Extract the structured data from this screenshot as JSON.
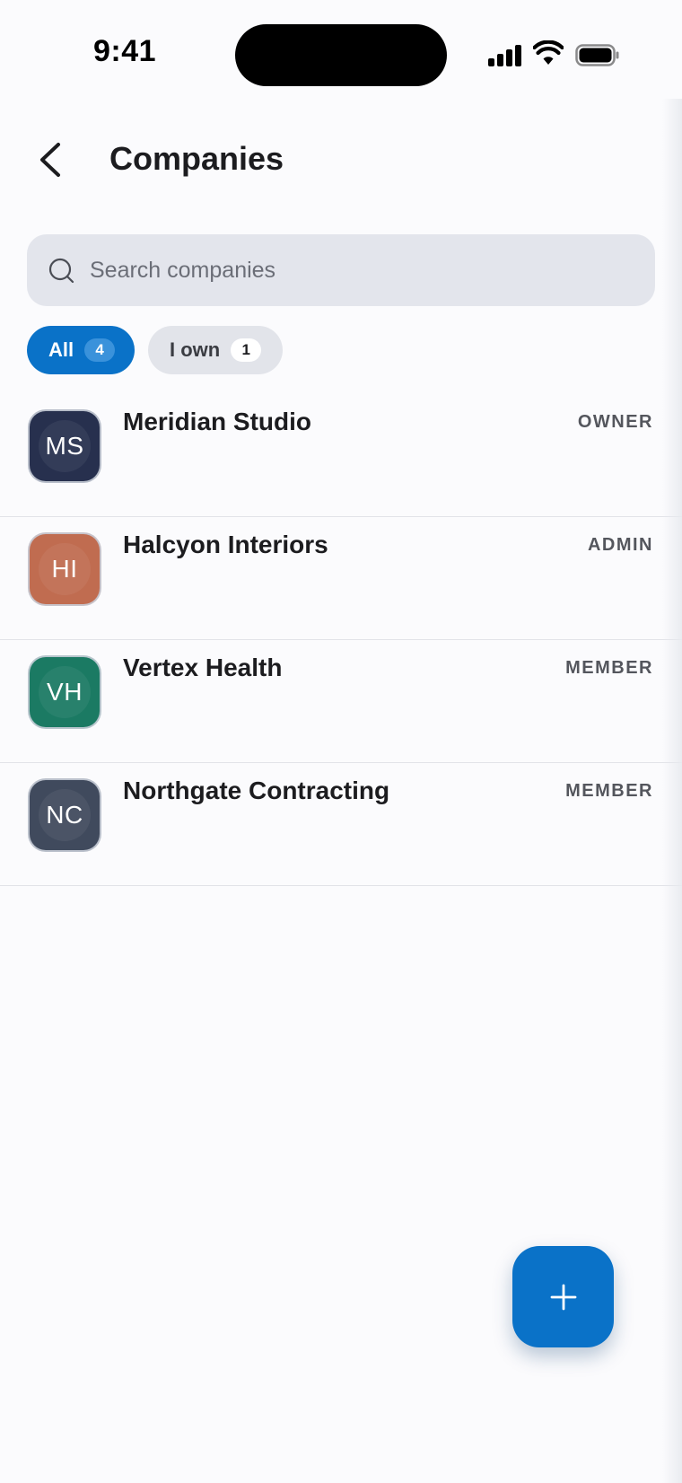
{
  "status_bar": {
    "time": "9:41"
  },
  "header": {
    "title": "Companies"
  },
  "search": {
    "placeholder": "Search companies"
  },
  "filters": [
    {
      "label": "All",
      "count": "4",
      "active": true
    },
    {
      "label": "I own",
      "count": "1",
      "active": false
    }
  ],
  "companies": [
    {
      "initials": "MS",
      "name": "Meridian Studio",
      "role": "OWNER",
      "color": "#27304e"
    },
    {
      "initials": "HI",
      "name": "Halcyon Interiors",
      "role": "ADMIN",
      "color": "#c06c50"
    },
    {
      "initials": "VH",
      "name": "Vertex Health",
      "role": "MEMBER",
      "color": "#1b7a63"
    },
    {
      "initials": "NC",
      "name": "Northgate Contracting",
      "role": "MEMBER",
      "color": "#404a5d"
    }
  ],
  "colors": {
    "accent": "#0a72c8",
    "search_bg": "#e3e5ec",
    "chip_inactive": "#e2e4ea"
  },
  "icons": {
    "back": "chevron-left-icon",
    "search": "search-icon",
    "fab": "plus-icon"
  }
}
